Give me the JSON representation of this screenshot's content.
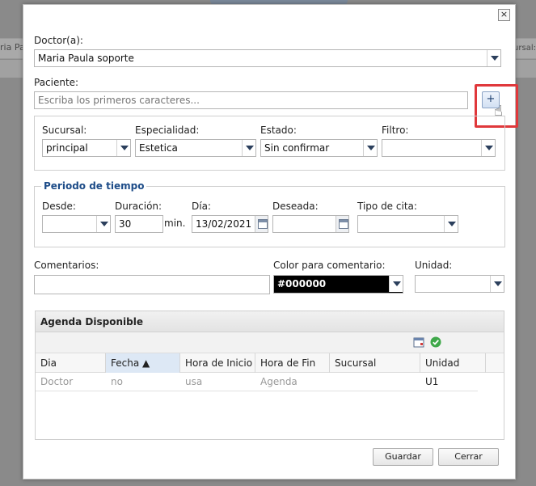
{
  "background": {
    "left_text": "ria Pa",
    "right_text": "cursal:"
  },
  "dialog": {
    "close": "×",
    "doctor": {
      "label": "Doctor(a):",
      "value": "Maria Paula soporte"
    },
    "paciente": {
      "label": "Paciente:",
      "placeholder": "Escriba los primeros caracteres...",
      "add": "+"
    },
    "sucursal": {
      "label": "Sucursal:",
      "value": "principal"
    },
    "especialidad": {
      "label": "Especialidad:",
      "value": "Estetica"
    },
    "estado": {
      "label": "Estado:",
      "value": "Sin confirmar"
    },
    "filtro": {
      "label": "Filtro:",
      "value": ""
    },
    "periodo": {
      "title": "Periodo de tiempo",
      "desde": {
        "label": "Desde:",
        "value": ""
      },
      "duracion": {
        "label": "Duración:",
        "value": "30",
        "unit": "min."
      },
      "dia": {
        "label": "Día:",
        "value": "13/02/2021"
      },
      "deseada": {
        "label": "Deseada:",
        "value": ""
      },
      "tipo": {
        "label": "Tipo de cita:",
        "value": ""
      }
    },
    "comentarios": {
      "label": "Comentarios:",
      "value": ""
    },
    "color": {
      "label": "Color para comentario:",
      "value": "#000000",
      "swatch": "#000000"
    },
    "unidad": {
      "label": "Unidad:",
      "value": ""
    },
    "agenda": {
      "title": "Agenda Disponible",
      "columns": [
        "Dia",
        "Fecha ▲",
        "Hora de Inicio",
        "Hora de Fin",
        "Sucursal",
        "Unidad"
      ],
      "row": [
        "Doctor",
        "no",
        "usa",
        "Agenda",
        "",
        "U1"
      ]
    },
    "buttons": {
      "save": "Guardar",
      "close": "Cerrar"
    }
  },
  "colors": {
    "accent": "#1d4c88",
    "highlight": "#e0383b"
  }
}
